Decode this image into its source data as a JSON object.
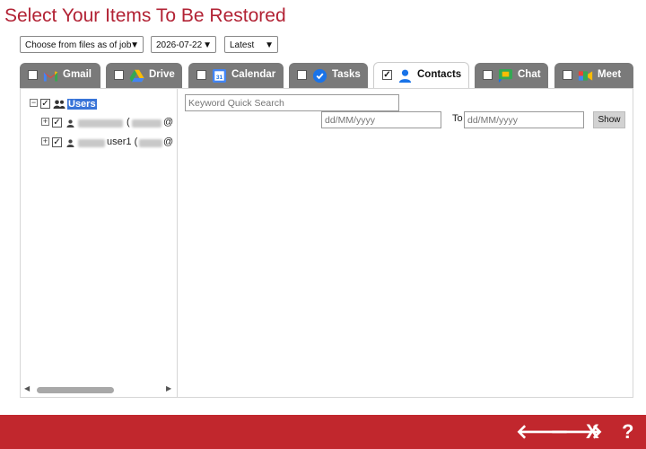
{
  "page": {
    "title": "Select Your Items To Be Restored"
  },
  "filters": {
    "mode": "Choose from files as of job",
    "date": "2026-07-22",
    "version": "Latest"
  },
  "tabs": [
    {
      "label": "Gmail",
      "checked": false,
      "active": false,
      "icon": "gmail-icon"
    },
    {
      "label": "Drive",
      "checked": false,
      "active": false,
      "icon": "drive-icon"
    },
    {
      "label": "Calendar",
      "checked": false,
      "active": false,
      "icon": "calendar-icon",
      "icon_text": "31"
    },
    {
      "label": "Tasks",
      "checked": false,
      "active": false,
      "icon": "tasks-icon"
    },
    {
      "label": "Contacts",
      "checked": true,
      "active": true,
      "icon": "contacts-icon"
    },
    {
      "label": "Chat",
      "checked": false,
      "active": false,
      "icon": "chat-icon"
    },
    {
      "label": "Meet",
      "checked": false,
      "active": false,
      "icon": "meet-icon"
    }
  ],
  "tree": {
    "root": {
      "label": "Users",
      "expand": "−",
      "checked": true
    },
    "users": [
      {
        "label_visible": "(",
        "suffix": "@",
        "expand": "+",
        "checked": true
      },
      {
        "label_visible": "user1 (",
        "suffix": "@",
        "expand": "+",
        "checked": true
      }
    ]
  },
  "search": {
    "keyword_placeholder": "Keyword Quick Search",
    "from_placeholder": "dd/MM/yyyy",
    "to_label": "To",
    "to_placeholder": "dd/MM/yyyy",
    "show_label": "Show"
  },
  "footer": {
    "back": "🡐",
    "next": "🡒",
    "close": "X",
    "help": "?"
  },
  "colors": {
    "brand": "#c1272d",
    "title": "#b22234",
    "tab_inactive": "#7a7a7a",
    "selection": "#3874d8"
  }
}
